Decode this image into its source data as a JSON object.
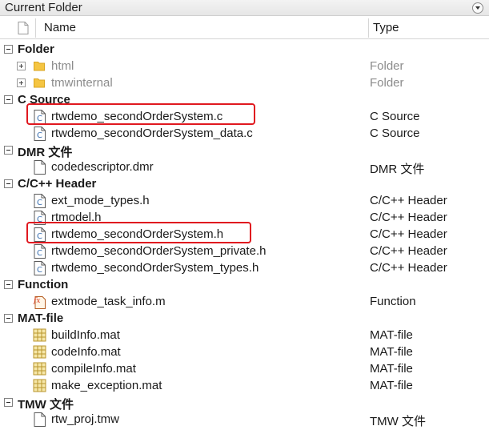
{
  "panel": {
    "title": "Current Folder"
  },
  "columns": {
    "name": "Name",
    "type": "Type"
  },
  "groups": [
    {
      "label": "Folder",
      "items": [
        {
          "name": "html",
          "type": "Folder"
        },
        {
          "name": "tmwinternal",
          "type": "Folder"
        }
      ]
    },
    {
      "label": "C Source",
      "items": [
        {
          "name": "rtwdemo_secondOrderSystem.c",
          "type": "C Source"
        },
        {
          "name": "rtwdemo_secondOrderSystem_data.c",
          "type": "C Source"
        }
      ]
    },
    {
      "label": "DMR 文件",
      "items": [
        {
          "name": "codedescriptor.dmr",
          "type": "DMR 文件"
        }
      ]
    },
    {
      "label": "C/C++ Header",
      "items": [
        {
          "name": "ext_mode_types.h",
          "type": "C/C++ Header"
        },
        {
          "name": "rtmodel.h",
          "type": "C/C++ Header"
        },
        {
          "name": "rtwdemo_secondOrderSystem.h",
          "type": "C/C++ Header"
        },
        {
          "name": "rtwdemo_secondOrderSystem_private.h",
          "type": "C/C++ Header"
        },
        {
          "name": "rtwdemo_secondOrderSystem_types.h",
          "type": "C/C++ Header"
        }
      ]
    },
    {
      "label": "Function",
      "items": [
        {
          "name": "extmode_task_info.m",
          "type": "Function"
        }
      ]
    },
    {
      "label": "MAT-file",
      "items": [
        {
          "name": "buildInfo.mat",
          "type": "MAT-file"
        },
        {
          "name": "codeInfo.mat",
          "type": "MAT-file"
        },
        {
          "name": "compileInfo.mat",
          "type": "MAT-file"
        },
        {
          "name": "make_exception.mat",
          "type": "MAT-file"
        }
      ]
    },
    {
      "label": "TMW 文件",
      "items": [
        {
          "name": "rtw_proj.tmw",
          "type": "TMW 文件"
        }
      ]
    }
  ],
  "icons": {
    "folder": "folder-icon",
    "c_file": "c-file-icon",
    "doc_file": "document-icon",
    "function": "function-file-icon",
    "mat_file": "mat-file-icon",
    "expand": "expand-icon",
    "collapse": "collapse-icon"
  },
  "colors": {
    "highlight": "#e0181f",
    "folder": "#f5c542",
    "muted_text": "#8c8c8c"
  }
}
